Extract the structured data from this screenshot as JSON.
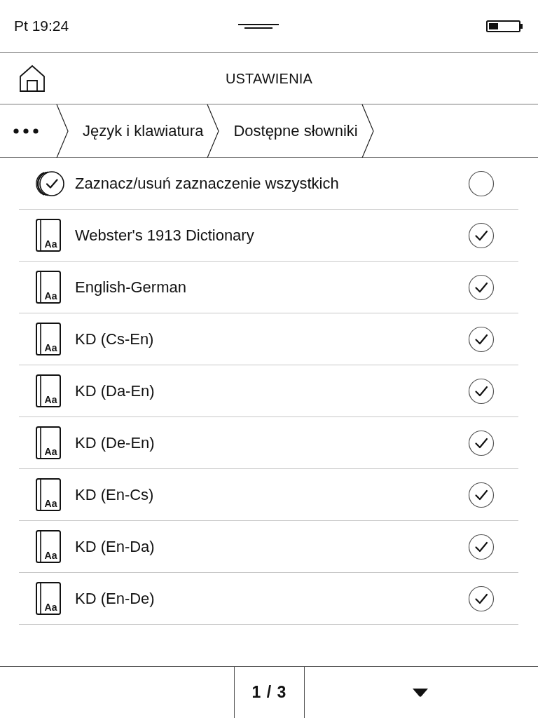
{
  "status_bar": {
    "time": "Pt 19:24"
  },
  "header": {
    "title": "USTAWIENIA"
  },
  "breadcrumbs": [
    {
      "label": "Język i klawiatura"
    },
    {
      "label": "Dostępne słowniki"
    }
  ],
  "select_all": {
    "label": "Zaznacz/usuń zaznaczenie wszystkich",
    "checked": false
  },
  "dictionaries": [
    {
      "name": "Webster's 1913 Dictionary",
      "icon_label": "Aa",
      "checked": true
    },
    {
      "name": "English-German",
      "icon_label": "Aa",
      "checked": true
    },
    {
      "name": "KD (Cs-En)",
      "icon_label": "Aa",
      "checked": true
    },
    {
      "name": "KD (Da-En)",
      "icon_label": "Aa",
      "checked": true
    },
    {
      "name": "KD (De-En)",
      "icon_label": "Aa",
      "checked": true
    },
    {
      "name": "KD (En-Cs)",
      "icon_label": "Aa",
      "checked": true
    },
    {
      "name": "KD (En-Da)",
      "icon_label": "Aa",
      "checked": true
    },
    {
      "name": "KD (En-De)",
      "icon_label": "Aa",
      "checked": true
    }
  ],
  "pager": {
    "page": "1 / 3"
  }
}
